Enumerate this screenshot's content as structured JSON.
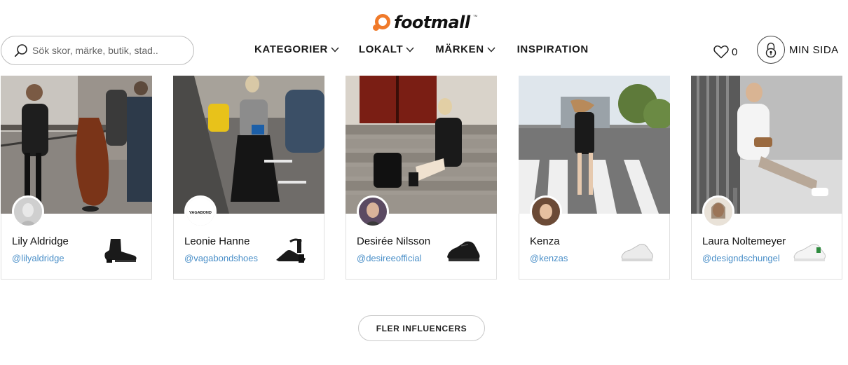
{
  "brand": {
    "name": "footmall",
    "trademark": "™",
    "accent_color": "#f07a2a"
  },
  "search": {
    "placeholder": "Sök skor, märke, butik, stad..",
    "icon": "search-icon"
  },
  "nav": [
    {
      "label": "KATEGORIER",
      "has_dropdown": true
    },
    {
      "label": "LOKALT",
      "has_dropdown": true
    },
    {
      "label": "MÄRKEN",
      "has_dropdown": true
    },
    {
      "label": "INSPIRATION",
      "has_dropdown": false
    }
  ],
  "favorites": {
    "count": "0",
    "icon": "heart-icon"
  },
  "account": {
    "label": "MIN SIDA",
    "icon": "lock-icon"
  },
  "influencers": [
    {
      "name": "Lily Aldridge",
      "handle": "@lilyaldridge",
      "shoe": "black-ankle-boot"
    },
    {
      "name": "Leonie Hanne",
      "handle": "@vagabondshoes",
      "shoe": "black-strappy-heel",
      "avatar_text": "VAGABOND"
    },
    {
      "name": "Desirée Nilsson",
      "handle": "@desireeofficial",
      "shoe": "black-wedge-sneaker"
    },
    {
      "name": "Kenza",
      "handle": "@kenzas",
      "shoe": "white-sneaker"
    },
    {
      "name": "Laura Noltemeyer",
      "handle": "@designdschungel",
      "shoe": "white-green-sneaker"
    }
  ],
  "more_button": {
    "label": "FLER INFLUENCERS"
  },
  "link_color": "#4a8fc8"
}
